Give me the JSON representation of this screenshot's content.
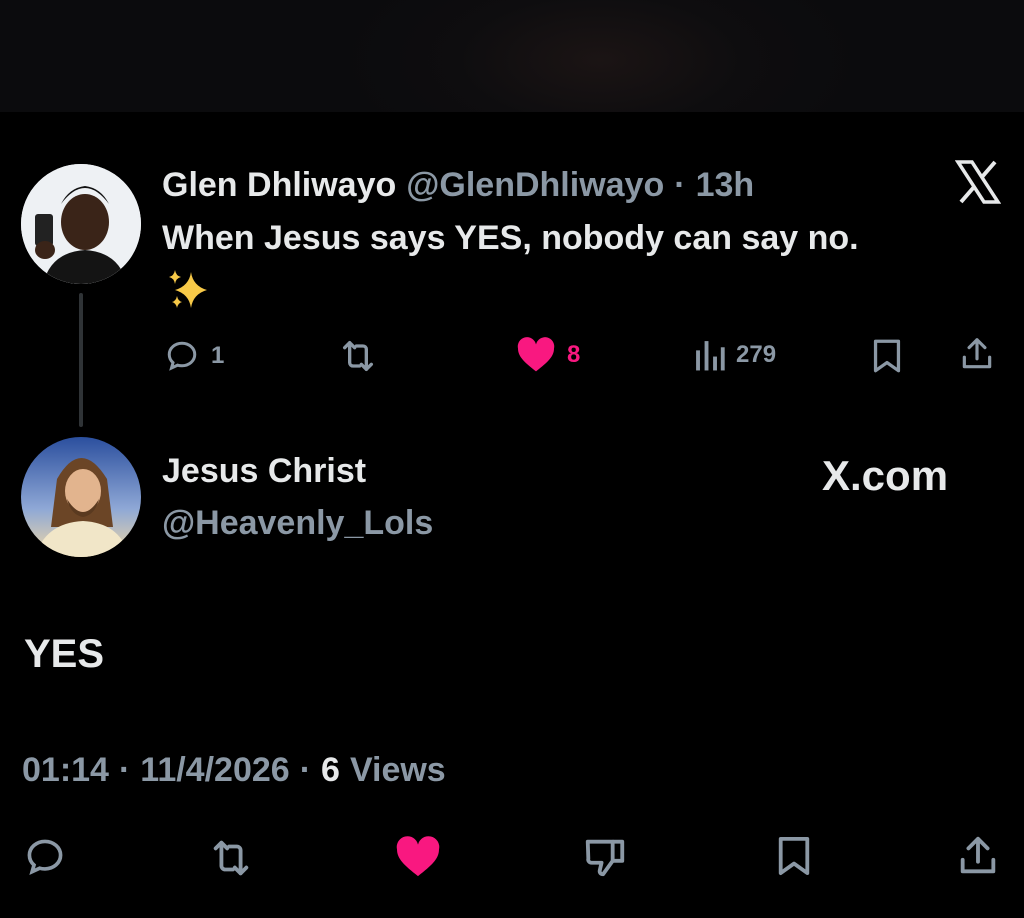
{
  "original_tweet": {
    "display_name": "Glen Dhliwayo",
    "handle": "@GlenDhliwayo",
    "separator": "·",
    "time_ago": "13h",
    "text": "When Jesus says YES, nobody can say no.",
    "emoji": "✨",
    "reply_count": "1",
    "like_count": "8",
    "view_count": "279",
    "platform_icon": "x-logo-icon"
  },
  "reply_tweet": {
    "display_name": "Jesus Christ",
    "handle": "@Heavenly_Lols",
    "brand_text": "X.com",
    "text": "YES",
    "time": "01:14",
    "separator": "·",
    "date": "11/4/2026",
    "views_count": "6",
    "views_label": "Views"
  },
  "colors": {
    "background": "#000000",
    "text_primary": "#e7e9ea",
    "text_muted": "#8b98a5",
    "like_pink": "#f91880",
    "thread_line": "#2f3336"
  }
}
